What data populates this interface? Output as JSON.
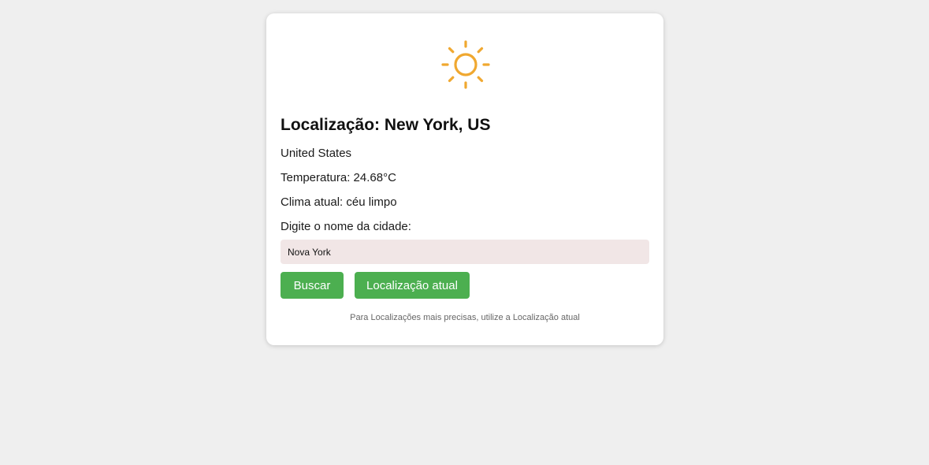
{
  "weather": {
    "icon": "sun-icon",
    "icon_color": "#f0a830",
    "title": "Localização: New York, US",
    "country": "United States",
    "temperature_label": "Temperatura:",
    "temperature_value": "24.68°C",
    "climate_label": "Clima atual:",
    "climate_value": "céu limpo"
  },
  "search": {
    "prompt": "Digite o nome da cidade:",
    "value": "Nova York",
    "input_bg": "#f1e6e6"
  },
  "buttons": {
    "search_label": "Buscar",
    "location_label": "Localização atual",
    "color": "#4caf50"
  },
  "hint": "Para Localizações mais precisas, utilize a Localização atual"
}
